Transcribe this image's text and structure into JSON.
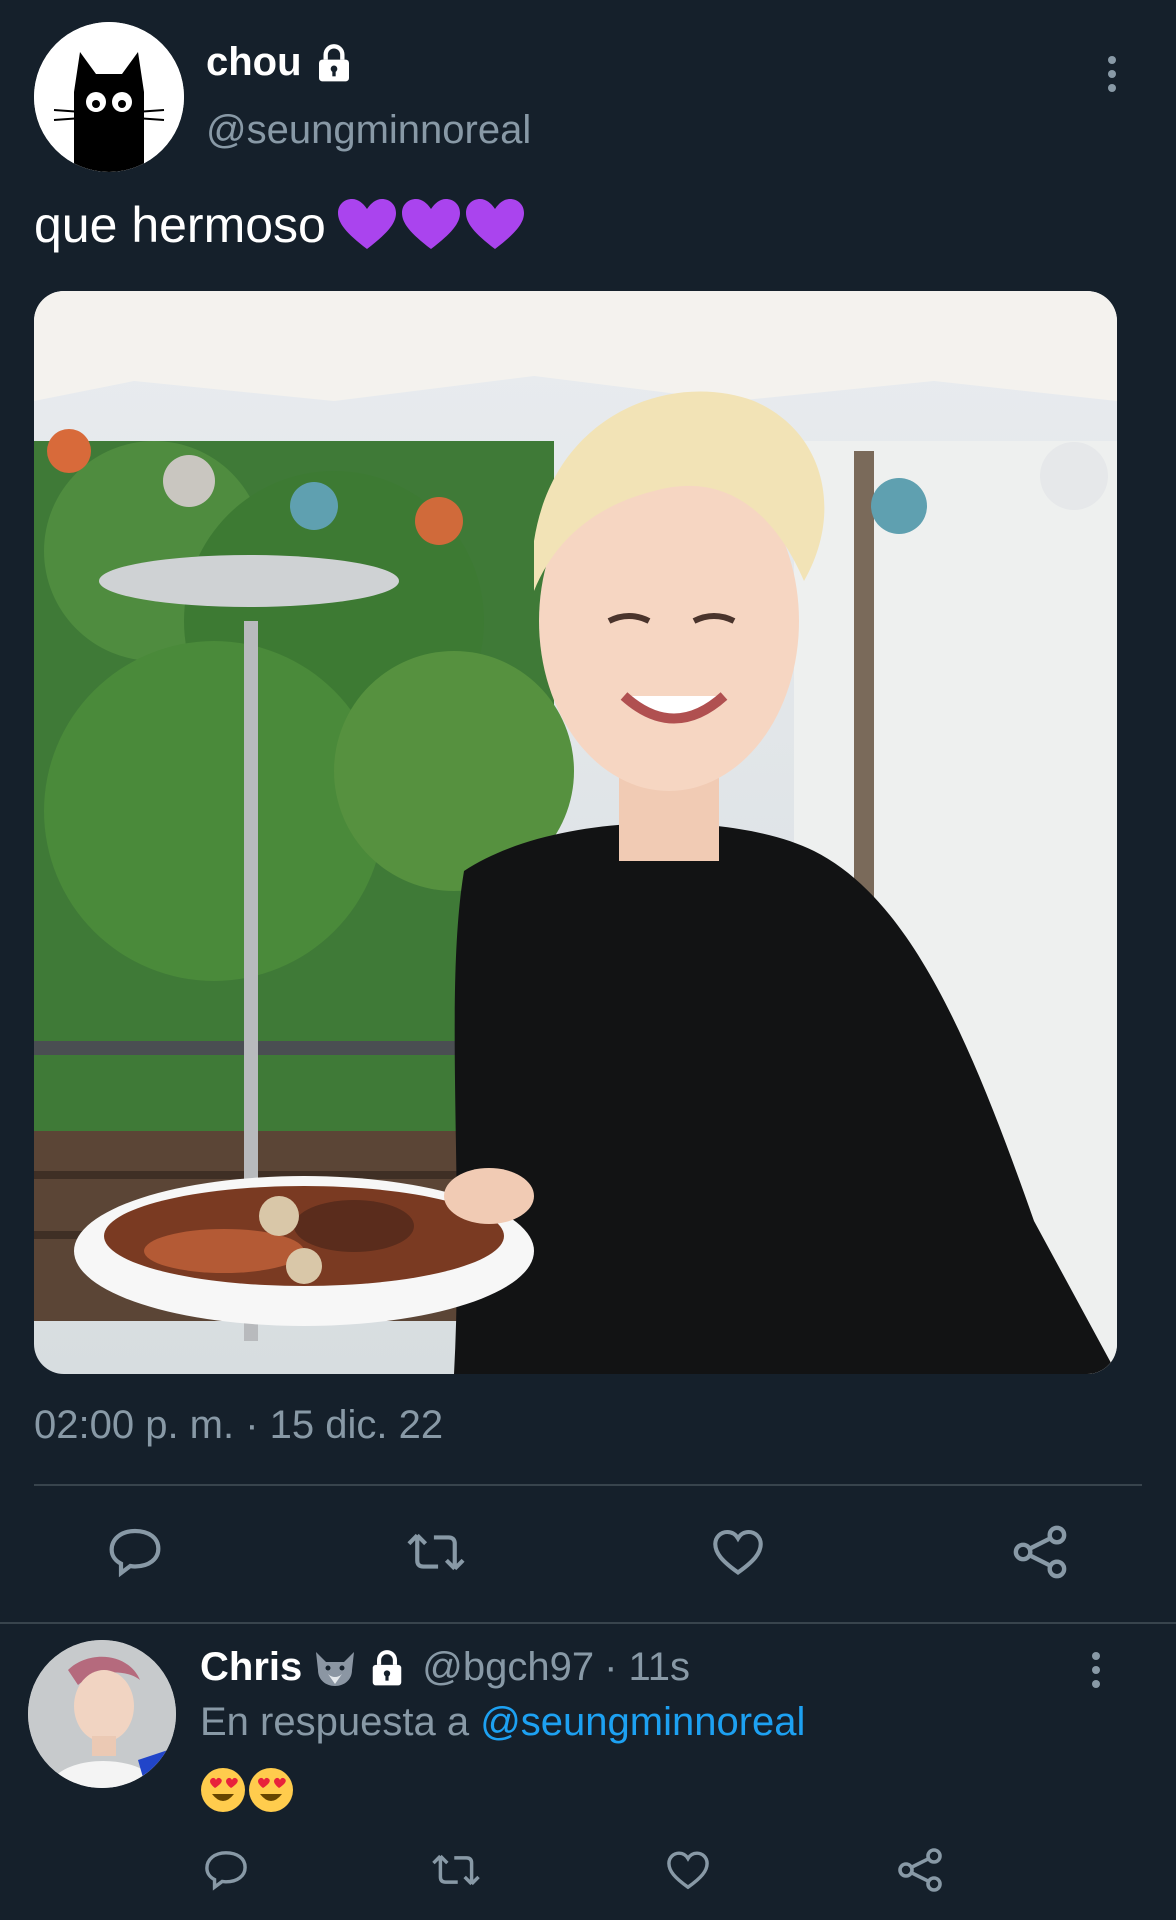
{
  "tweet": {
    "author_name": "chou",
    "author_handle": "@seungminnoreal",
    "text": "que hermoso",
    "text_emoji": [
      "purple-heart",
      "purple-heart",
      "purple-heart"
    ],
    "timestamp": "02:00 p. m. · 15 dic. 22",
    "locked": true
  },
  "actions": [
    "reply-icon",
    "retweet-icon",
    "like-icon",
    "share-icon"
  ],
  "reply": {
    "author_name": "Chris",
    "author_handle": "@bgch97",
    "time": "· 11s",
    "reply_prefix": "En respuesta a",
    "reply_mention": "@seungminnoreal",
    "text_emoji": [
      "heart-eyes",
      "heart-eyes"
    ],
    "locked": true
  },
  "colors": {
    "background": "#15202b",
    "secondary_text": "#8899a6",
    "link": "#1da1f2",
    "divider": "#38444d"
  }
}
